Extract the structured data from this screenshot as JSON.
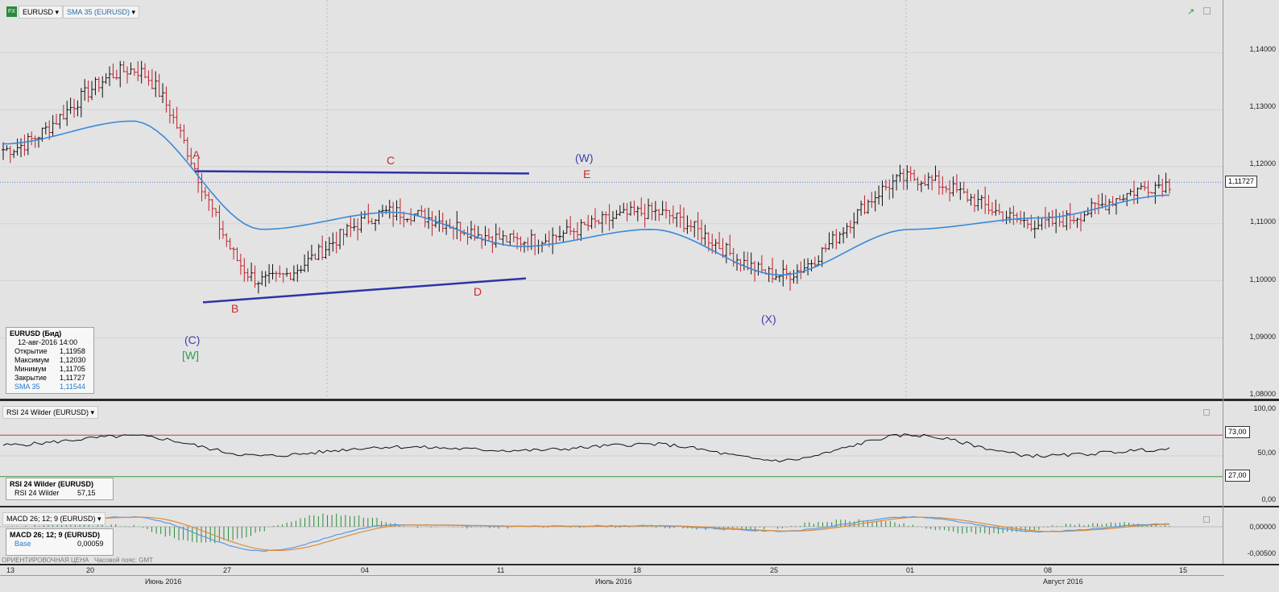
{
  "toolbar": {
    "symbol": "EURUSD",
    "sma": "SMA 35 (EURUSD)",
    "rsi": "RSI 24 Wilder (EURUSD)",
    "macd": "MACD 26; 12; 9 (EURUSD)",
    "fx_badge": "FX"
  },
  "info_main": {
    "title": "EURUSD (Бид)",
    "datetime": "12-авг-2016 14:00",
    "rows": [
      {
        "k": "Открытие",
        "v": "1,11958"
      },
      {
        "k": "Максимум",
        "v": "1,12030"
      },
      {
        "k": "Минимум",
        "v": "1,11705"
      },
      {
        "k": "Закрытие",
        "v": "1,11727"
      },
      {
        "k": "SMA 35",
        "v": "1,11544"
      }
    ]
  },
  "info_rsi": {
    "title": "RSI 24 Wilder (EURUSD)",
    "k": "RSI 24 Wilder",
    "v": "57,15"
  },
  "info_macd": {
    "title": "MACD 26; 12; 9 (EURUSD)",
    "k": "Base",
    "v": "0,00059"
  },
  "footer_note": "ОРИЕНТИРОВОЧНАЯ ЦЕНА   Часовой пояс: GMT",
  "price_axis": [
    "1,14000",
    "1,13000",
    "1,12000",
    "1,11000",
    "1,10000",
    "1,09000",
    "1,08000"
  ],
  "last_price": "1,11727",
  "rsi_axis": [
    "100,00",
    "73,00",
    "50,00",
    "27,00",
    "0,00"
  ],
  "macd_axis": [
    "0,00000",
    "-0,00500"
  ],
  "x_days": [
    "13",
    "20",
    "27",
    "04",
    "11",
    "18",
    "25",
    "01",
    "08",
    "15"
  ],
  "x_months": [
    "Июнь 2016",
    "Июль 2016",
    "Август 2016"
  ],
  "wave_labels": {
    "A": "A",
    "B": "B",
    "C": "C",
    "D": "D",
    "E": "E",
    "C_paren": "(C)",
    "W_bracket": "[W]",
    "W_paren": "(W)",
    "X_paren": "(X)"
  },
  "colors": {
    "up": "#c0202a",
    "down": "#111111",
    "sma": "#3a8ad8",
    "trend": "#2c34a8",
    "wave_red": "#d0282c",
    "wave_blue": "#3b3fb0",
    "wave_green": "#2aa04a",
    "rsi_upper": "#c04040",
    "rsi_lower": "#3a9a3a"
  },
  "chart_data": [
    {
      "type": "line",
      "title": "EURUSD (Бид)",
      "series": [
        {
          "name": "EURUSD",
          "x": [
            "13",
            "20",
            "27",
            "04",
            "11",
            "18",
            "25",
            "01",
            "08",
            "15"
          ],
          "values": [
            1.123,
            1.137,
            1.1,
            1.112,
            1.107,
            1.112,
            1.101,
            1.118,
            1.11,
            1.117
          ]
        },
        {
          "name": "SMA 35",
          "x": [
            "13",
            "20",
            "27",
            "04",
            "11",
            "18",
            "25",
            "01",
            "08",
            "15"
          ],
          "values": [
            1.124,
            1.128,
            1.109,
            1.112,
            1.106,
            1.109,
            1.101,
            1.109,
            1.111,
            1.115
          ]
        }
      ],
      "ylim": [
        1.08,
        1.145
      ]
    },
    {
      "type": "line",
      "title": "RSI 24 Wilder (EURUSD)",
      "series": [
        {
          "name": "RSI 24 Wilder",
          "values": [
            62,
            72,
            50,
            60,
            56,
            63,
            45,
            73,
            50,
            57.15
          ]
        }
      ],
      "ylim": [
        0,
        100
      ]
    },
    {
      "type": "line",
      "title": "MACD 26; 12; 9 (EURUSD)",
      "series": [
        {
          "name": "Base",
          "values": [
            0.001,
            0.002,
            -0.005,
            0.0004,
            0.0001,
            0.0002,
            -0.0009,
            0.002,
            -0.001,
            0.00059
          ]
        }
      ],
      "ylim": [
        -0.007,
        0.003
      ]
    }
  ]
}
